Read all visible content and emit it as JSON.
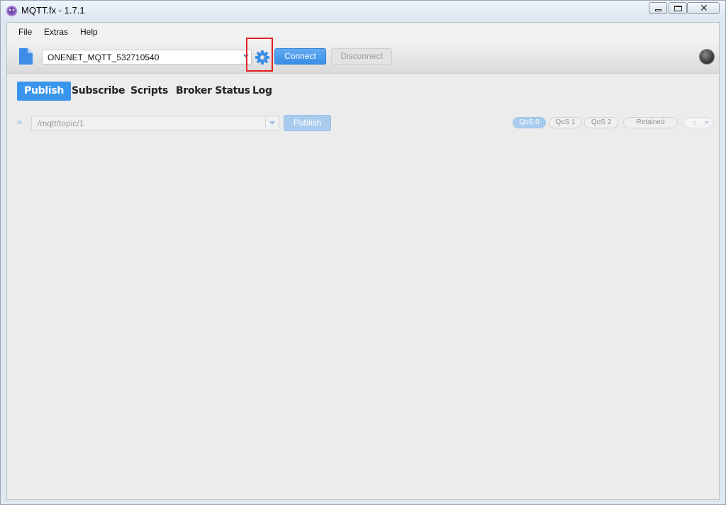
{
  "window": {
    "title": "MQTT.fx - 1.7.1",
    "close_glyph": "✕",
    "icon": "mqttfx-app-icon"
  },
  "menu": {
    "items": [
      "File",
      "Extras",
      "Help"
    ]
  },
  "toolbar": {
    "profile_value": "ONENET_MQTT_532710540",
    "connect_label": "Connect",
    "disconnect_label": "Disconnect",
    "connection_status": "disconnected",
    "accent_color": "#3a95ec",
    "highlight_color": "#e02222"
  },
  "tabs": [
    {
      "label": "Publish",
      "active": true
    },
    {
      "label": "Subscribe",
      "active": false
    },
    {
      "label": "Scripts",
      "active": false
    },
    {
      "label": "Broker Status",
      "active": false
    },
    {
      "label": "Log",
      "active": false
    }
  ],
  "publish": {
    "topic_placeholder": "/mqtt/topic/1",
    "publish_label": "Publish",
    "qos": [
      {
        "label": "QoS 0",
        "selected": true
      },
      {
        "label": "QoS 1",
        "selected": false
      },
      {
        "label": "QoS 2",
        "selected": false
      }
    ],
    "retained_label": "Retained",
    "options_label": "o"
  }
}
